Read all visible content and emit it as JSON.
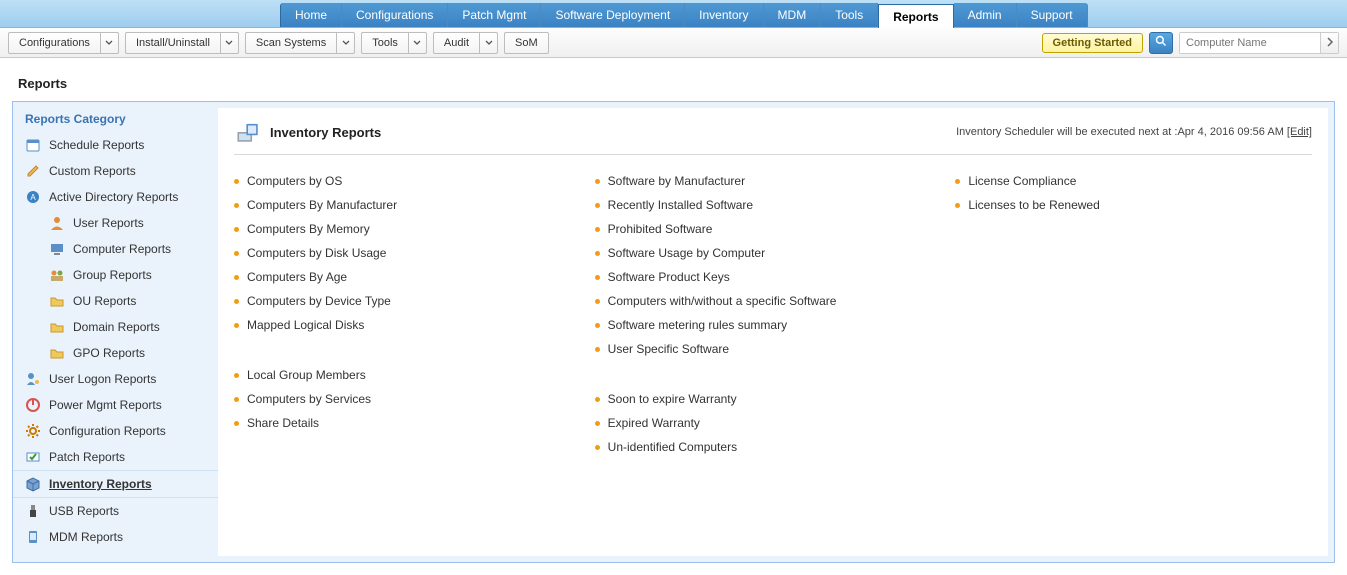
{
  "topnav": {
    "tabs": [
      "Home",
      "Configurations",
      "Patch Mgmt",
      "Software Deployment",
      "Inventory",
      "MDM",
      "Tools",
      "Reports",
      "Admin",
      "Support"
    ],
    "active_index": 7
  },
  "subnav": {
    "buttons": [
      {
        "label": "Configurations",
        "dropdown": true
      },
      {
        "label": "Install/Uninstall",
        "dropdown": true
      },
      {
        "label": "Scan Systems",
        "dropdown": true
      },
      {
        "label": "Tools",
        "dropdown": true
      },
      {
        "label": "Audit",
        "dropdown": true
      },
      {
        "label": "SoM",
        "dropdown": false
      }
    ],
    "getting_started": "Getting Started",
    "search_placeholder": "Computer Name"
  },
  "page_title": "Reports",
  "sidebar": {
    "title": "Reports Category",
    "items": [
      {
        "label": "Schedule Reports",
        "icon": "calendar"
      },
      {
        "label": "Custom Reports",
        "icon": "pencil"
      },
      {
        "label": "Active Directory Reports",
        "icon": "ad"
      },
      {
        "label": "User Reports",
        "icon": "user",
        "child": true
      },
      {
        "label": "Computer Reports",
        "icon": "computer",
        "child": true
      },
      {
        "label": "Group Reports",
        "icon": "group",
        "child": true
      },
      {
        "label": "OU Reports",
        "icon": "folder",
        "child": true
      },
      {
        "label": "Domain Reports",
        "icon": "folder",
        "child": true
      },
      {
        "label": "GPO Reports",
        "icon": "folder",
        "child": true
      },
      {
        "label": "User Logon Reports",
        "icon": "userkey"
      },
      {
        "label": "Power Mgmt Reports",
        "icon": "power"
      },
      {
        "label": "Configuration Reports",
        "icon": "gear"
      },
      {
        "label": "Patch Reports",
        "icon": "patch"
      },
      {
        "label": "Inventory Reports",
        "icon": "box",
        "active": true
      },
      {
        "label": "USB Reports",
        "icon": "usb"
      },
      {
        "label": "MDM Reports",
        "icon": "mdm"
      }
    ]
  },
  "main": {
    "title": "Inventory Reports",
    "scheduler_msg": "Inventory Scheduler will be executed next at :Apr 4, 2016 09:56 AM ",
    "edit": "[Edit]",
    "columns": [
      {
        "group1": [
          "Computers by OS",
          "Computers By Manufacturer",
          "Computers By Memory",
          "Computers by Disk Usage",
          "Computers By Age",
          "Computers by Device Type",
          "Mapped Logical Disks"
        ],
        "group2": [
          "Local Group Members",
          "Computers by Services",
          "Share Details"
        ]
      },
      {
        "group1": [
          "Software by Manufacturer",
          "Recently Installed Software",
          "Prohibited Software",
          "Software Usage by Computer",
          "Software Product Keys",
          "Computers with/without a specific Software",
          "Software metering rules summary",
          "User Specific Software"
        ],
        "group2": [
          "Soon to expire Warranty",
          "Expired Warranty",
          "Un-identified Computers"
        ]
      },
      {
        "group1": [
          "License Compliance",
          "Licenses to be Renewed"
        ],
        "group2": []
      }
    ]
  }
}
